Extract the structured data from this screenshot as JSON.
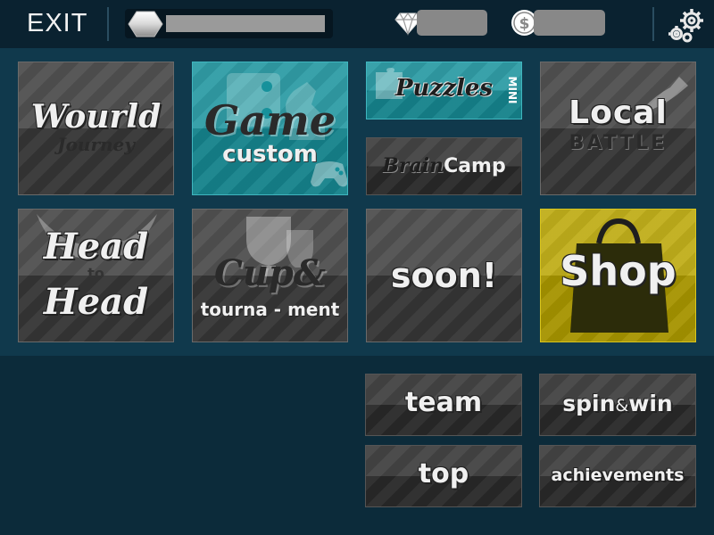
{
  "header": {
    "exit_label": "EXIT",
    "xp_progress": 1.0,
    "gems": "",
    "coins": ""
  },
  "tiles": {
    "world_journey": {
      "title": "Wourld",
      "subtitle": "Journey"
    },
    "custom_game": {
      "title": "Game",
      "subtitle": "custom"
    },
    "puzzles_mini": {
      "title": "Puzzles",
      "badge": "MINI"
    },
    "brain_camp": {
      "title_a": "Brain",
      "title_b": "Camp"
    },
    "local_battle": {
      "title": "Local",
      "subtitle": "BATTLE"
    },
    "head_to_head": {
      "line1": "Head",
      "line2": "to",
      "line3": "Head"
    },
    "cup_tournament": {
      "title": "Cup&",
      "subtitle": "tourna - ment"
    },
    "soon": {
      "title": "soon!"
    },
    "shop": {
      "title": "Shop"
    }
  },
  "buttons": {
    "team": "team",
    "spin_win_a": "spin",
    "spin_win_amp": "&",
    "spin_win_b": "win",
    "top": "top",
    "achievements": "achievements"
  },
  "colors": {
    "background": "#0c2b3a",
    "tile_grey": "#3b3b3b",
    "tile_teal": "#17919b",
    "tile_yellow": "#b9a500"
  }
}
